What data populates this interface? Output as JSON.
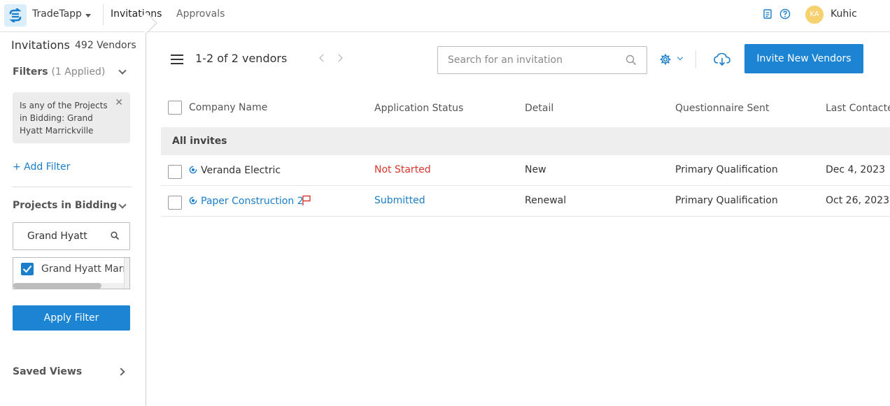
{
  "header": {
    "app_name": "TradeTapp",
    "tabs": [
      "Invitations",
      "Approvals"
    ],
    "user_initials": "KA",
    "user_name": "Kuhic"
  },
  "sidebar": {
    "title": "Invitations",
    "vendor_total": "492 Vendors",
    "filters_label": "Filters",
    "filters_applied": "(1 Applied)",
    "filter_chip": "Is any of the Projects in Bidding: Grand Hyatt Marrickville",
    "add_filter": "+ Add Filter",
    "projects_label": "Projects in Bidding",
    "project_search_value": "Grand Hyatt",
    "project_options": [
      {
        "label": "Grand Hyatt Marrickville",
        "checked": true
      }
    ],
    "apply_label": "Apply Filter",
    "saved_views_label": "Saved Views"
  },
  "toolbar": {
    "vendor_range": "1-2 of 2 vendors",
    "search_placeholder": "Search for an invitation",
    "invite_label": "Invite New Vendors"
  },
  "table": {
    "columns": [
      "Company Name",
      "Application Status",
      "Detail",
      "Questionnaire Sent",
      "Last Contacted"
    ],
    "group_label": "All invites",
    "rows": [
      {
        "company": "Veranda Electric",
        "status": "Not Started",
        "detail": "New",
        "questionnaire": "Primary Qualification",
        "last_contacted": "Dec 4, 2023"
      },
      {
        "company": "Paper Construction 2",
        "status": "Submitted",
        "detail": "Renewal",
        "questionnaire": "Primary Qualification",
        "last_contacted": "Oct 26, 2023"
      }
    ]
  },
  "colors": {
    "accent": "#1b84d3",
    "status_not_started": "#d9382d",
    "status_submitted": "#1b7ecb",
    "avatar": "#f7d070"
  },
  "icons": [
    "app-logo-icon",
    "caret-down-icon",
    "document-icon",
    "help-icon",
    "chevron-down-icon",
    "close-icon",
    "search-icon",
    "checkmark-icon",
    "chevron-right-icon",
    "menu-icon",
    "chevron-left-icon",
    "gear-icon",
    "cloud-download-icon",
    "invite-status-icon",
    "flag-icon"
  ]
}
